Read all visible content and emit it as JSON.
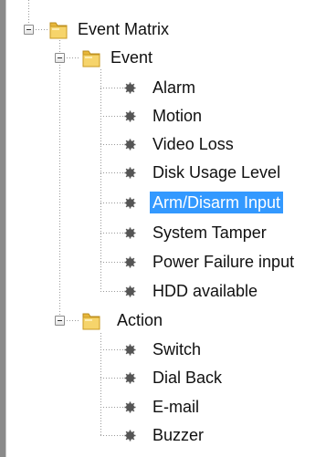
{
  "tree": {
    "root_label": "Event Matrix",
    "event_group": {
      "label": "Event",
      "items": [
        {
          "label": "Alarm"
        },
        {
          "label": "Motion"
        },
        {
          "label": "Video Loss"
        },
        {
          "label": "Disk Usage Level"
        },
        {
          "label": "Arm/Disarm Input",
          "selected": true
        },
        {
          "label": "System Tamper"
        },
        {
          "label": "Power Failure input"
        },
        {
          "label": "HDD available"
        }
      ]
    },
    "action_group": {
      "label": "Action",
      "items": [
        {
          "label": "Switch"
        },
        {
          "label": "Dial Back"
        },
        {
          "label": "E-mail"
        },
        {
          "label": "Buzzer"
        }
      ]
    }
  },
  "colors": {
    "selection": "#3399ff",
    "folder": "#f2c94c",
    "bullet": "#555555"
  },
  "icons": {
    "expander": "minus-box-icon",
    "folder": "folder-icon",
    "leaf": "gear-bullet-icon"
  }
}
